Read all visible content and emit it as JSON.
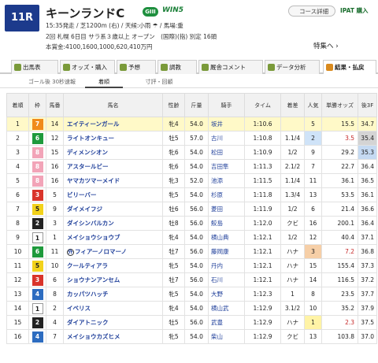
{
  "header": {
    "race_no": "11R",
    "race_name": "キーンランドC",
    "grade": "GIII",
    "win5": "WIN5",
    "meta_line1": "15:35発走 / 芝1200m (右) / 天候:小雨 ☂ / 馬場:重",
    "meta_line2": "2回 札幌 6日目 サラ系３歳以上 オープン　(国際)(指) 別定 16頭",
    "meta_line3": "本賞金:4100,1600,1000,620,410万円",
    "course_btn": "コース詳細",
    "ipat_btn": "IPAT 購入",
    "tokusen": "特集へ ›"
  },
  "tabs": [
    {
      "label": "出馬表",
      "icon": "list-icon",
      "active": false
    },
    {
      "label": "オッズ・購入",
      "icon": "odds-icon",
      "active": false
    },
    {
      "label": "予想",
      "icon": "prediction-icon",
      "active": false
    },
    {
      "label": "調教",
      "icon": "training-icon",
      "active": false
    },
    {
      "label": "厩舎コメント",
      "icon": "comment-icon",
      "active": false
    },
    {
      "label": "データ分析",
      "icon": "chart-icon",
      "active": false
    },
    {
      "label": "結果・払戻",
      "icon": "result-icon",
      "active": true
    }
  ],
  "subtabs": [
    {
      "label": "ゴール後 30秒速報",
      "active": false
    },
    {
      "label": "着順",
      "active": true
    },
    {
      "label": "寸評・回顧",
      "active": false
    }
  ],
  "columns": [
    "着順",
    "枠",
    "馬番",
    "馬名",
    "性齢",
    "斤量",
    "騎手",
    "タイム",
    "着差",
    "人気",
    "単勝オッズ",
    "後3F"
  ],
  "colors": {
    "waku_1": "#ffffff",
    "waku_2": "#222222",
    "waku_3": "#d9342b",
    "waku_4": "#2d6cc0",
    "waku_5": "#f2d21b",
    "waku_6": "#1e9a3c",
    "waku_7": "#f08b1a",
    "waku_8": "#f2a4b8"
  },
  "rows": [
    {
      "rank": "1",
      "waku": 7,
      "num": "14",
      "name": "エイティーンガール",
      "sexage": "牝4",
      "kinryo": "54.0",
      "jockey": "坂井",
      "time": "1:10.6",
      "margin": "",
      "pop": "5",
      "odds": "15.5",
      "odds_red": false,
      "last3f": "34.7",
      "f3rank": 1,
      "pop_rank": 0
    },
    {
      "rank": "2",
      "waku": 6,
      "num": "12",
      "name": "ライトオンキュー",
      "sexage": "牡5",
      "kinryo": "57.0",
      "jockey": "古川",
      "time": "1:10.8",
      "margin": "1.1/4",
      "pop": "2",
      "odds": "3.5",
      "odds_red": true,
      "last3f": "35.4",
      "f3rank": 2,
      "pop_rank": 2
    },
    {
      "rank": "3",
      "waku": 8,
      "num": "15",
      "name": "ディメンシオン",
      "sexage": "牝6",
      "kinryo": "54.0",
      "jockey": "松田",
      "time": "1:10.9",
      "margin": "1/2",
      "pop": "9",
      "odds": "29.2",
      "odds_red": false,
      "last3f": "35.3",
      "f3rank": 3,
      "pop_rank": 0
    },
    {
      "rank": "4",
      "waku": 8,
      "num": "16",
      "name": "アスタールビー",
      "sexage": "牝6",
      "kinryo": "54.0",
      "jockey": "吉田隼",
      "time": "1:11.3",
      "margin": "2.1/2",
      "pop": "7",
      "odds": "22.7",
      "odds_red": false,
      "last3f": "36.4",
      "f3rank": 0,
      "pop_rank": 0
    },
    {
      "rank": "5",
      "waku": 8,
      "num": "16",
      "name": "ヤマカツマーメイド",
      "sexage": "牝3",
      "kinryo": "52.0",
      "jockey": "池添",
      "time": "1:11.5",
      "margin": "1.1/4",
      "pop": "11",
      "odds": "36.1",
      "odds_red": false,
      "last3f": "36.5",
      "f3rank": 0,
      "pop_rank": 0
    },
    {
      "rank": "6",
      "waku": 3,
      "num": "5",
      "name": "ビリーバー",
      "sexage": "牝5",
      "kinryo": "54.0",
      "jockey": "杉原",
      "time": "1:11.8",
      "margin": "1.3/4",
      "pop": "13",
      "odds": "53.5",
      "odds_red": false,
      "last3f": "36.1",
      "f3rank": 0,
      "pop_rank": 0
    },
    {
      "rank": "7",
      "waku": 5,
      "num": "9",
      "name": "ダイメイフジ",
      "sexage": "牡6",
      "kinryo": "56.0",
      "jockey": "菱田",
      "time": "1:11.9",
      "margin": "1/2",
      "pop": "6",
      "odds": "21.4",
      "odds_red": false,
      "last3f": "36.6",
      "f3rank": 0,
      "pop_rank": 0
    },
    {
      "rank": "8",
      "waku": 2,
      "num": "3",
      "name": "ダイシンバルカン",
      "sexage": "牡8",
      "kinryo": "56.0",
      "jockey": "鮫島",
      "time": "1:12.0",
      "margin": "クビ",
      "pop": "16",
      "odds": "200.1",
      "odds_red": false,
      "last3f": "36.4",
      "f3rank": 0,
      "pop_rank": 0
    },
    {
      "rank": "9",
      "waku": 1,
      "num": "1",
      "name": "メイショウショウブ",
      "sexage": "牝4",
      "kinryo": "54.0",
      "jockey": "横山典",
      "time": "1:12.1",
      "margin": "1/2",
      "pop": "12",
      "odds": "40.4",
      "odds_red": false,
      "last3f": "37.1",
      "f3rank": 0,
      "pop_rank": 0
    },
    {
      "rank": "10",
      "waku": 6,
      "num": "11",
      "name": "フィアーノロマーノ",
      "sexage": "牡7",
      "kinryo": "56.0",
      "jockey": "藤岡康",
      "time": "1:12.1",
      "margin": "ハナ",
      "pop": "3",
      "odds": "7.2",
      "odds_red": true,
      "last3f": "36.8",
      "f3rank": 0,
      "pop_rank": 3,
      "mark": "外"
    },
    {
      "rank": "11",
      "waku": 5,
      "num": "10",
      "name": "クールティアラ",
      "sexage": "牝5",
      "kinryo": "54.0",
      "jockey": "丹内",
      "time": "1:12.1",
      "margin": "ハナ",
      "pop": "15",
      "odds": "155.4",
      "odds_red": false,
      "last3f": "37.3",
      "f3rank": 0,
      "pop_rank": 0
    },
    {
      "rank": "12",
      "waku": 3,
      "num": "6",
      "name": "ショウナンアンセム",
      "sexage": "牡7",
      "kinryo": "56.0",
      "jockey": "石川",
      "time": "1:12.1",
      "margin": "ハナ",
      "pop": "14",
      "odds": "116.5",
      "odds_red": false,
      "last3f": "37.2",
      "f3rank": 0,
      "pop_rank": 0
    },
    {
      "rank": "13",
      "waku": 4,
      "num": "8",
      "name": "カッパツハッチ",
      "sexage": "牝5",
      "kinryo": "54.0",
      "jockey": "大野",
      "time": "1:12.3",
      "margin": "1",
      "pop": "8",
      "odds": "23.5",
      "odds_red": false,
      "last3f": "37.7",
      "f3rank": 0,
      "pop_rank": 0
    },
    {
      "rank": "14",
      "waku": 1,
      "num": "2",
      "name": "イベリス",
      "sexage": "牝4",
      "kinryo": "54.0",
      "jockey": "横山武",
      "time": "1:12.9",
      "margin": "3.1/2",
      "pop": "10",
      "odds": "35.2",
      "odds_red": false,
      "last3f": "37.9",
      "f3rank": 0,
      "pop_rank": 0
    },
    {
      "rank": "15",
      "waku": 2,
      "num": "4",
      "name": "ダイアトニック",
      "sexage": "牡5",
      "kinryo": "56.0",
      "jockey": "武豊",
      "time": "1:12.9",
      "margin": "ハナ",
      "pop": "1",
      "odds": "2.3",
      "odds_red": true,
      "last3f": "37.5",
      "f3rank": 0,
      "pop_rank": 1
    },
    {
      "rank": "16",
      "waku": 4,
      "num": "7",
      "name": "メイショウカズヒメ",
      "sexage": "牝5",
      "kinryo": "54.0",
      "jockey": "柴山",
      "time": "1:12.9",
      "margin": "クビ",
      "pop": "13",
      "odds": "103.8",
      "odds_red": false,
      "last3f": "37.0",
      "f3rank": 0,
      "pop_rank": 0
    }
  ]
}
